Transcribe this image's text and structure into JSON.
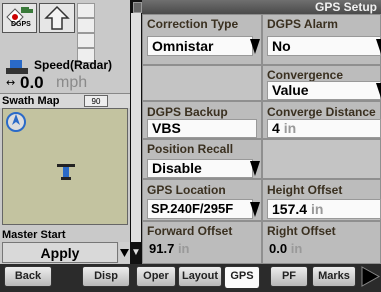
{
  "header": {
    "title": "GPS Setup"
  },
  "left": {
    "dgps_label": "DGPS",
    "speed_label": "Speed(Radar)",
    "speed_value": "0.0",
    "speed_unit": "mph",
    "swath_title": "Swath Map",
    "swath_badge": "90",
    "master_start_label": "Master Start",
    "apply_label": "Apply"
  },
  "fields": {
    "correction_type": {
      "label": "Correction Type",
      "value": "Omnistar"
    },
    "dgps_alarm": {
      "label": "DGPS Alarm",
      "value": "No"
    },
    "convergence_status": {
      "label": "Convergence Status",
      "value": "Value"
    },
    "dgps_backup": {
      "label": "DGPS Backup",
      "value": "VBS"
    },
    "converge_distance": {
      "label": "Converge Distance",
      "value": "4",
      "unit": "in"
    },
    "position_recall": {
      "label": "Position Recall",
      "value": "Disable"
    },
    "gps_location": {
      "label": "GPS Location",
      "value": "SP.240F/295F"
    },
    "height_offset": {
      "label": "Height Offset",
      "value": "157.4",
      "unit": "in"
    },
    "forward_offset": {
      "label": "Forward Offset",
      "value": "91.7",
      "unit": "in"
    },
    "right_offset": {
      "label": "Right Offset",
      "value": "0.0",
      "unit": "in"
    }
  },
  "tabs": [
    "Back",
    "Disp",
    "Oper",
    "Layout",
    "GPS",
    "PF",
    "Marks"
  ],
  "active_tab": "GPS"
}
